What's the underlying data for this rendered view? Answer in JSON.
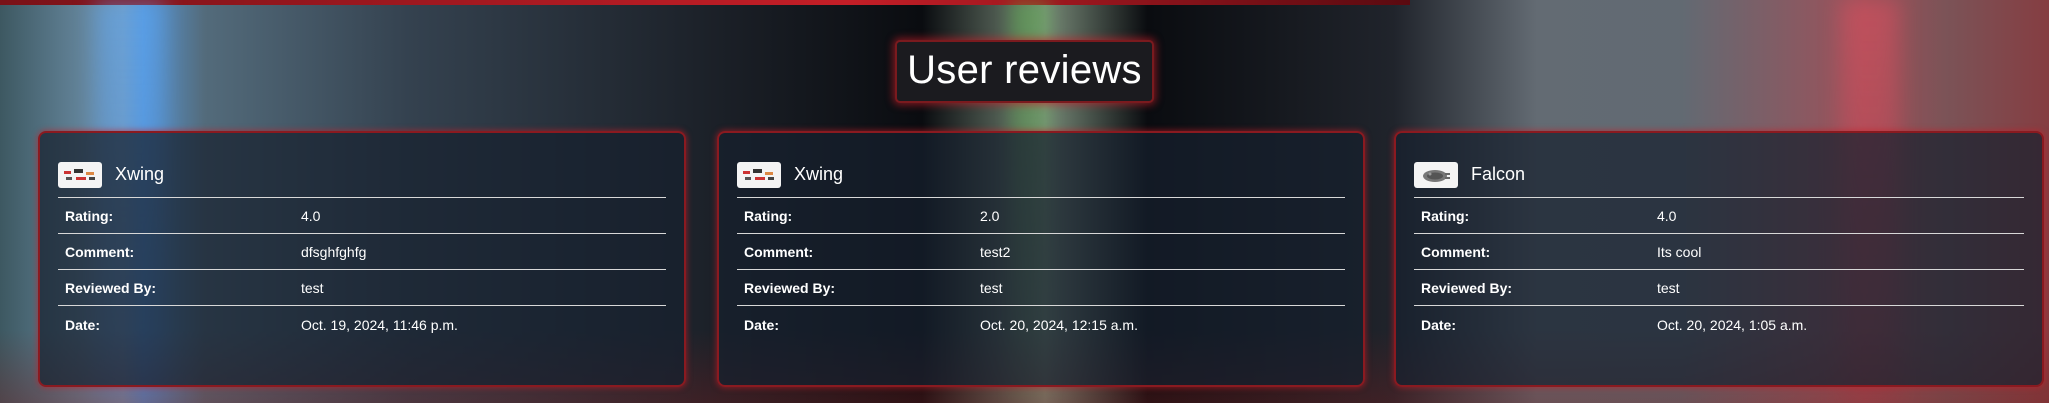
{
  "page": {
    "heading": "User reviews"
  },
  "labels": {
    "rating": "Rating:",
    "comment": "Comment:",
    "reviewed_by": "Reviewed By:",
    "date": "Date:"
  },
  "reviews": [
    {
      "product": "Xwing",
      "thumbnail": "xwing-toy-icon",
      "rating": "4.0",
      "comment": "dfsghfghfg",
      "reviewed_by": "test",
      "date": "Oct. 19, 2024, 11:46 p.m."
    },
    {
      "product": "Xwing",
      "thumbnail": "xwing-toy-icon",
      "rating": "2.0",
      "comment": "test2",
      "reviewed_by": "test",
      "date": "Oct. 20, 2024, 12:15 a.m."
    },
    {
      "product": "Falcon",
      "thumbnail": "falcon-ship-icon",
      "rating": "4.0",
      "comment": "Its cool",
      "reviewed_by": "test",
      "date": "Oct. 20, 2024, 1:05 a.m."
    }
  ],
  "colors": {
    "accent": "#c41e27",
    "card_bg": "#16202e",
    "heading_bg": "#1b1b1f"
  }
}
